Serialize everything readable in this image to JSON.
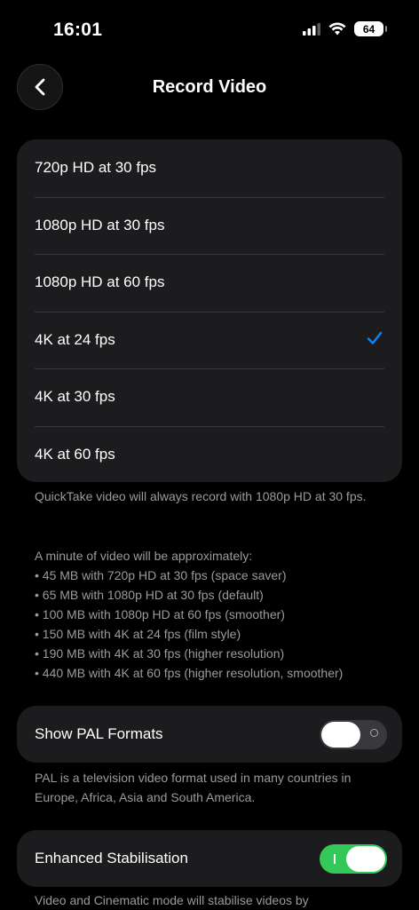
{
  "status_bar": {
    "time": "16:01",
    "battery": "64"
  },
  "nav": {
    "title": "Record Video",
    "back_icon": "chevron-left-icon"
  },
  "options": [
    {
      "label": "720p HD at 30 fps",
      "selected": false
    },
    {
      "label": "1080p HD at 30 fps",
      "selected": false
    },
    {
      "label": "1080p HD at 60 fps",
      "selected": false
    },
    {
      "label": "4K at 24 fps",
      "selected": true
    },
    {
      "label": "4K at 30 fps",
      "selected": false
    },
    {
      "label": "4K at 60 fps",
      "selected": false
    }
  ],
  "notes": {
    "quicktake": "QuickTake video will always record with 1080p HD at 30 fps.",
    "minute_intro": "A minute of video will be approximately:",
    "sizes": [
      "45 MB with 720p HD at 30 fps (space saver)",
      "65 MB with 1080p HD at 30 fps (default)",
      "100 MB with 1080p HD at 60 fps (smoother)",
      "150 MB with 4K at 24 fps (film style)",
      "190 MB with 4K at 30 fps (higher resolution)",
      "440 MB with 4K at 60 fps (higher resolution, smoother)"
    ]
  },
  "pal": {
    "label": "Show PAL Formats",
    "enabled": false,
    "description": "PAL is a television video format used in many countries in Europe, Africa, Asia and South America."
  },
  "stabilisation": {
    "label": "Enhanced Stabilisation",
    "enabled": true,
    "description": "Video and Cinematic mode will stabilise videos by"
  },
  "colors": {
    "accent": "#0a84ff",
    "toggle_on": "#34c759",
    "group_bg": "#1c1c1e"
  }
}
